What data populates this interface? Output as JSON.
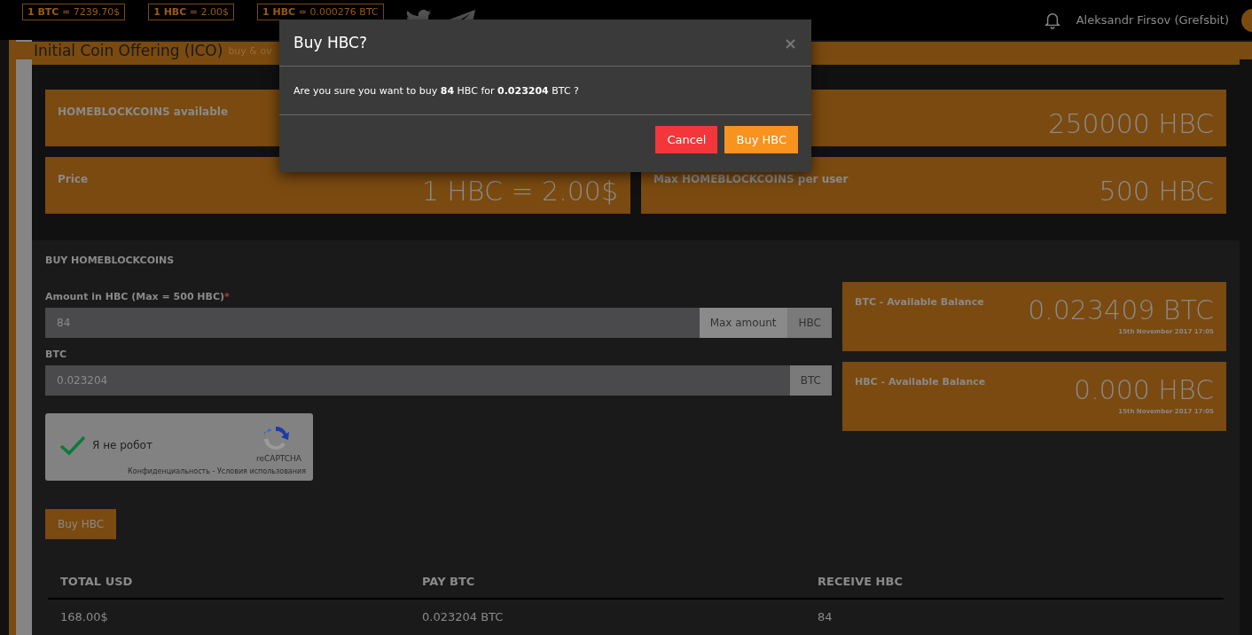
{
  "top_bar": {
    "rates": [
      "**1 BTC** = 7239.70$",
      "**1 HBC** = 2.00$",
      "**1 HBC** = 0.000276 BTC"
    ],
    "user_name": "Aleksandr Firsov (Grefsbit)"
  },
  "header": {
    "title": "Initial Coin Offering (ICO)",
    "subtitle": "buy & ov"
  },
  "stats": [
    {
      "label": "HOMEBLOCKCOINS available"
    },
    {
      "value": "250000 HBC"
    },
    {
      "label": "Price",
      "value": "1 HBC = 2.00$"
    },
    {
      "label": "Max HOMEBLOCKCOINS per user",
      "value": "500 HBC"
    }
  ],
  "buy_panel": {
    "title": "BUY HOMEBLOCKCOINS",
    "amount": {
      "label": "Amount in HBC (Max = 500 HBC)",
      "required_mark": "*",
      "value": "84",
      "max_button": "Max amount",
      "unit": "HBC"
    },
    "btc": {
      "label": "BTC",
      "value": "0.023204",
      "unit": "BTC"
    },
    "captcha": {
      "checked": true,
      "label": "Я не робот",
      "brand": "reCAPTCHA",
      "links": "Конфиденциальность - Условия использования"
    },
    "submit": "Buy HBC",
    "balances": [
      {
        "label": "BTC - Available Balance",
        "value": "0.023409 BTC",
        "date": "15th November 2017 17:05"
      },
      {
        "label": "HBC - Available Balance",
        "value": "0.000 HBC",
        "date": "15th November 2017 17:05"
      }
    ],
    "table": {
      "columns": [
        "TOTAL USD",
        "PAY BTC",
        "RECEIVE HBC"
      ],
      "rows": [
        [
          "168.00$",
          "0.023204 BTC",
          "84"
        ]
      ]
    }
  },
  "modal": {
    "title": "Buy HBC?",
    "close": "×",
    "message": "Are you sure you want to buy **84** HBC for **0.023204** BTC ?",
    "cancel": "Cancel",
    "confirm": "Buy HBC"
  }
}
